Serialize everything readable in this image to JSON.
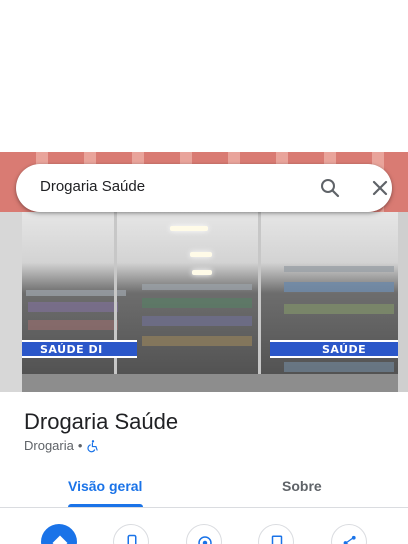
{
  "search": {
    "query": "Drogaria Saúde"
  },
  "photo": {
    "banner_left": "SAÚDE DI",
    "banner_right": "SAÚDE"
  },
  "place": {
    "name": "Drogaria Saúde",
    "category": "Drogaria",
    "separator": "•"
  },
  "tabs": [
    {
      "label": "Visão geral",
      "selected": true
    },
    {
      "label": "Sobre",
      "selected": false
    }
  ],
  "actions": [
    {
      "icon": "directions-icon"
    },
    {
      "icon": "phone-icon"
    },
    {
      "icon": "location-icon"
    },
    {
      "icon": "save-icon"
    },
    {
      "icon": "share-icon"
    }
  ],
  "colors": {
    "accent": "#1a73e8",
    "text_primary": "#202124",
    "text_secondary": "#5f6368"
  }
}
